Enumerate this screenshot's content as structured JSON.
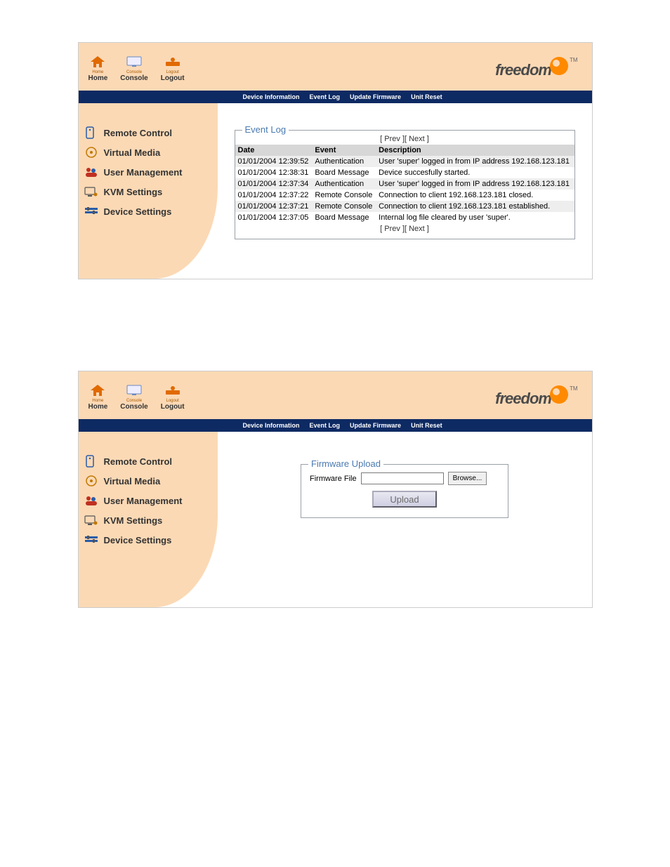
{
  "top_icons": {
    "home": {
      "tiny": "Home",
      "label": "Home"
    },
    "console": {
      "tiny": "Console",
      "label": "Console"
    },
    "logout": {
      "tiny": "Logout",
      "label": "Logout"
    }
  },
  "brand": {
    "name": "freedom",
    "suffix_tm": "TM"
  },
  "menubar": {
    "device_info": "Device Information",
    "event_log": "Event Log",
    "update_fw": "Update Firmware",
    "unit_reset": "Unit Reset"
  },
  "sidebar": {
    "items": [
      {
        "label": "Remote Control"
      },
      {
        "label": "Virtual Media"
      },
      {
        "label": "User Management"
      },
      {
        "label": "KVM Settings"
      },
      {
        "label": "Device Settings"
      }
    ]
  },
  "eventlog": {
    "title": "Event Log",
    "pager_prev": "[ Prev ]",
    "pager_next": "[ Next ]",
    "headers": {
      "date": "Date",
      "event": "Event",
      "desc": "Description"
    },
    "rows": [
      {
        "date": "01/01/2004 12:39:52",
        "event": "Authentication",
        "desc": "User 'super' logged in from IP address 192.168.123.181"
      },
      {
        "date": "01/01/2004 12:38:31",
        "event": "Board Message",
        "desc": "Device succesfully started."
      },
      {
        "date": "01/01/2004 12:37:34",
        "event": "Authentication",
        "desc": "User 'super' logged in from IP address 192.168.123.181"
      },
      {
        "date": "01/01/2004 12:37:22",
        "event": "Remote Console",
        "desc": "Connection to client 192.168.123.181 closed."
      },
      {
        "date": "01/01/2004 12:37:21",
        "event": "Remote Console",
        "desc": "Connection to client 192.168.123.181 established."
      },
      {
        "date": "01/01/2004 12:37:05",
        "event": "Board Message",
        "desc": "Internal log file cleared by user 'super'."
      }
    ]
  },
  "firmware": {
    "title": "Firmware Upload",
    "file_label": "Firmware File",
    "browse": "Browse...",
    "upload": "Upload"
  }
}
